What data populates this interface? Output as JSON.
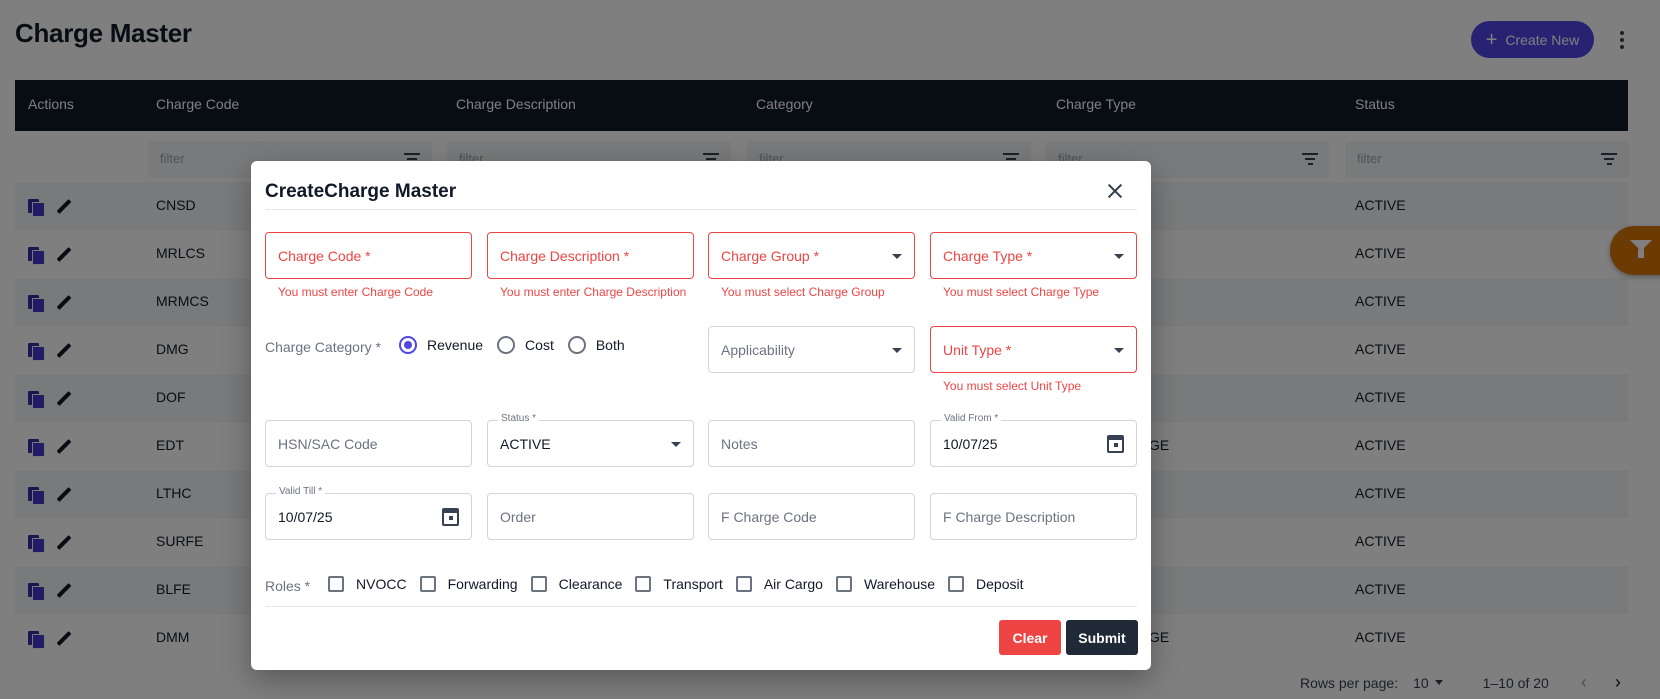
{
  "page": {
    "title": "Charge Master",
    "create_button": "Create New"
  },
  "table": {
    "headers": [
      "Actions",
      "Charge Code",
      "Charge Description",
      "Category",
      "Charge Type",
      "Status"
    ],
    "filter_placeholder": "filter",
    "rows": [
      {
        "code": "CNSD",
        "type": "",
        "status": "ACTIVE"
      },
      {
        "code": "MRLCS",
        "type": "",
        "status": "ACTIVE"
      },
      {
        "code": "MRMCS",
        "type": "",
        "status": "ACTIVE"
      },
      {
        "code": "DMG",
        "type": "",
        "status": "ACTIVE"
      },
      {
        "code": "DOF",
        "type": "",
        "status": "ACTIVE"
      },
      {
        "code": "EDT",
        "type": "GE",
        "status": "ACTIVE"
      },
      {
        "code": "LTHC",
        "type": "",
        "status": "ACTIVE"
      },
      {
        "code": "SURFE",
        "type": "",
        "status": "ACTIVE"
      },
      {
        "code": "BLFE",
        "type": "",
        "status": "ACTIVE"
      },
      {
        "code": "DMM",
        "type": "GE",
        "status": "ACTIVE"
      }
    ]
  },
  "pagination": {
    "rows_per_page_label": "Rows per page:",
    "rows_per_page_value": "10",
    "range": "1–10 of 20"
  },
  "dialog": {
    "title": "CreateCharge Master",
    "charge_code": {
      "placeholder": "Charge Code *",
      "error": "You must enter Charge Code"
    },
    "charge_description": {
      "placeholder": "Charge Description *",
      "error": "You must enter Charge Description"
    },
    "charge_group": {
      "placeholder": "Charge Group *",
      "error": "You must select Charge Group"
    },
    "charge_type": {
      "placeholder": "Charge Type *",
      "error": "You must select Charge Type"
    },
    "charge_category": {
      "label": "Charge Category *",
      "options": [
        "Revenue",
        "Cost",
        "Both"
      ],
      "selected": "Revenue"
    },
    "applicability": {
      "placeholder": "Applicability"
    },
    "unit_type": {
      "placeholder": "Unit Type *",
      "error": "You must select Unit Type"
    },
    "hsn_sac_code": {
      "placeholder": "HSN/SAC Code"
    },
    "status": {
      "label": "Status *",
      "value": "ACTIVE"
    },
    "notes": {
      "placeholder": "Notes"
    },
    "valid_from": {
      "label": "Valid From *",
      "value": "10/07/25"
    },
    "valid_till": {
      "label": "Valid Till *",
      "value": "10/07/25"
    },
    "order": {
      "placeholder": "Order"
    },
    "f_charge_code": {
      "placeholder": "F Charge Code"
    },
    "f_charge_description": {
      "placeholder": "F Charge Description"
    },
    "roles": {
      "label": "Roles *",
      "options": [
        "NVOCC",
        "Forwarding",
        "Clearance",
        "Transport",
        "Air Cargo",
        "Warehouse",
        "Deposit"
      ]
    },
    "clear_button": "Clear",
    "submit_button": "Submit"
  },
  "colors": {
    "primary": "#4f46e5",
    "error": "#ef4444",
    "header_dark": "#111827",
    "fab": "#d97706"
  }
}
